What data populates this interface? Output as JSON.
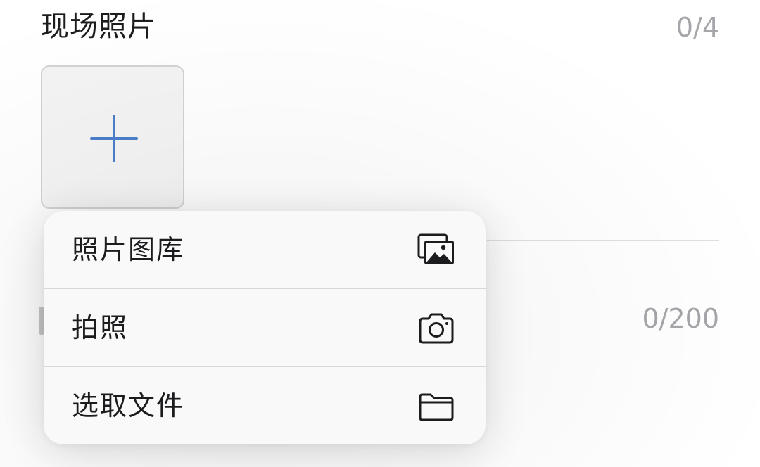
{
  "section": {
    "title": "现场照片",
    "photo_count": "0/4"
  },
  "upload": {
    "icon": "plus-icon",
    "accent_color": "#4a7fcb"
  },
  "text_field": {
    "char_count": "0/200"
  },
  "menu": {
    "items": [
      {
        "label": "照片图库",
        "icon": "photo-library-icon"
      },
      {
        "label": "拍照",
        "icon": "camera-icon"
      },
      {
        "label": "选取文件",
        "icon": "folder-icon"
      }
    ]
  }
}
